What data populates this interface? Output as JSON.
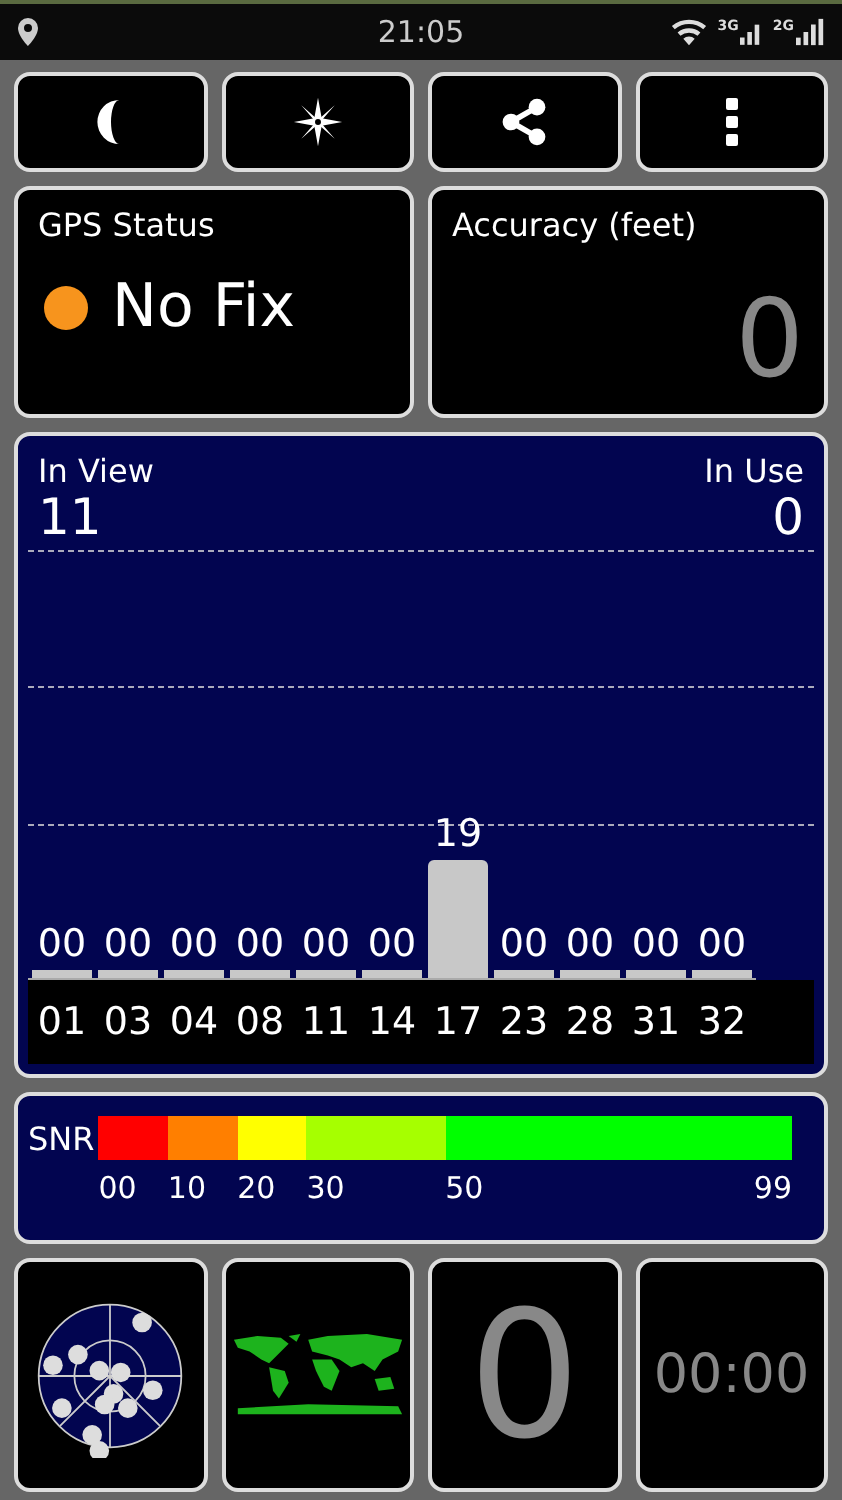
{
  "status_bar": {
    "time": "21:05",
    "network_1": "3G",
    "network_2": "2G"
  },
  "toolbar": [
    {
      "kind": "night"
    },
    {
      "kind": "compass"
    },
    {
      "kind": "share"
    },
    {
      "kind": "menu"
    }
  ],
  "gps_status": {
    "title": "GPS Status",
    "value": "No Fix",
    "color": "#f7941d"
  },
  "accuracy": {
    "title": "Accuracy (feet)",
    "value": "0"
  },
  "satellites": {
    "in_view_label": "In View",
    "in_view": "11",
    "in_use_label": "In Use",
    "in_use": "0",
    "chart_data": {
      "type": "bar",
      "categories": [
        "01",
        "03",
        "04",
        "08",
        "11",
        "14",
        "17",
        "23",
        "28",
        "31",
        "32"
      ],
      "values": [
        0,
        0,
        0,
        0,
        0,
        0,
        19,
        0,
        0,
        0,
        0
      ],
      "value_labels": [
        "00",
        "00",
        "00",
        "00",
        "00",
        "00",
        "19",
        "00",
        "00",
        "00",
        "00"
      ]
    }
  },
  "snr": {
    "label": "SNR",
    "scale": [
      {
        "label": "00",
        "color": "#ff0000"
      },
      {
        "label": "10",
        "color": "#ff7f00"
      },
      {
        "label": "20",
        "color": "#ffff00"
      },
      {
        "label": "30",
        "color": "#a6ff00"
      },
      {
        "label": "50",
        "color": "#00ff00"
      }
    ],
    "max_label": "99"
  },
  "bottom": {
    "speed": "0",
    "timer": "00:00"
  }
}
